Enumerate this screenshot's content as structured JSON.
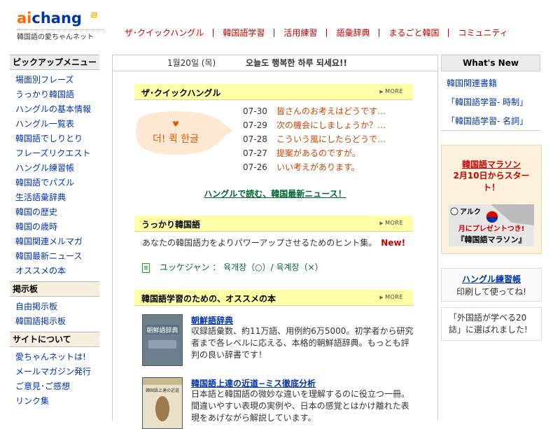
{
  "logo": {
    "word": "aichang",
    "word_accent": "ai",
    "word_rest": "chang",
    "subtitle": "韓国語の愛ちゃんネット"
  },
  "nav": [
    "ザ･クイックハングル",
    "韓国語学習",
    "活用練習",
    "語彙辞典",
    "まるごと韓国",
    "コミュニティ"
  ],
  "sidebar": {
    "pickup_header": "ピックアップメニュー",
    "pickup_items": [
      "場面別フレーズ",
      "うっかり韓国語",
      "ハングルの基本情報",
      "ハングル一覧表",
      "韓国語でしりとり",
      "フレーズリクエスト",
      "ハングル練習帳",
      "韓国語でパズル",
      "生活語彙辞典",
      "韓国の歴史",
      "韓国の歳時",
      "韓国関連メルマガ",
      "韓国最新ニュース",
      "オススメの本"
    ],
    "board_header": "掲示板",
    "board_items": [
      "自由掲示板",
      "韓国語掲示板"
    ],
    "about_header": "サイトについて",
    "about_items": [
      "愛ちゃんネットは!",
      "メールマガジン発行",
      "ご意見･ご感想",
      "リンク集"
    ]
  },
  "main": {
    "date": "1월20일 (목)",
    "greeting": "오늘도 행복한 하루 되세요!!",
    "more_label": "MORE",
    "quick": {
      "title": "ザ･クイックハングル",
      "bubble_text": "더! 퀵 한글",
      "news": [
        {
          "date": "07-30",
          "title": "皆さんのお考えはどうです…"
        },
        {
          "date": "07-29",
          "title": "次の機会にしましょうか？…"
        },
        {
          "date": "07-28",
          "title": "こういう風にしたらどうで…"
        },
        {
          "date": "07-27",
          "title": "提案があるのですが。"
        },
        {
          "date": "07-26",
          "title": "いい考えがあります。"
        }
      ],
      "headline": "ハングルで読む、韓国最新ニュース！"
    },
    "ukkari": {
      "title": "うっかり韓国語",
      "hint": "あなたの韓国語力をよりパワーアップさせるためのヒント集。",
      "new_label": "New!",
      "vocab": "ユッケジャン ： 육개장（○）/ 육계장（×）"
    },
    "books": {
      "title": "韓国語学習のための、オススメの本",
      "items": [
        {
          "title": "朝鮮語辞典",
          "cover_text": "朝鮮語辞典",
          "desc": "収録語彙数、約11万語、用例約6万5000。初学者から研究者まで各レベルに応える、本格的朝鮮語辞典。もっとも評判の良い辞書です！"
        },
        {
          "title": "韓国語上達の近道−ミス徹底分析",
          "cover_text": "韓国語上達の近道",
          "desc": "日本語と韓国語の微妙な違いを理解するのに役立つ一冊。間違いやすい表現の実例や、日本の感覚とはかけ離れた表現をあげながら解説しています。"
        }
      ]
    }
  },
  "right": {
    "whats_new_header": "What's New",
    "whats_new": [
      "韓国関連書籍",
      "「韓国語学習- 時制」",
      "「韓国語学習- 名詞」"
    ],
    "marathon_title": "韓国語マラソン",
    "marathon_sub": "2月10日からスタート！",
    "banner_brand": "アルク",
    "banner_text1": "月にプレゼントつき!",
    "banner_text2": "『韓国語マラソン』",
    "hangul_title": "ハングル練習帳",
    "hangul_text": "印刷して使ってね!",
    "foreign_text": "「外国語が学べる20誌」に選ばれました!"
  }
}
